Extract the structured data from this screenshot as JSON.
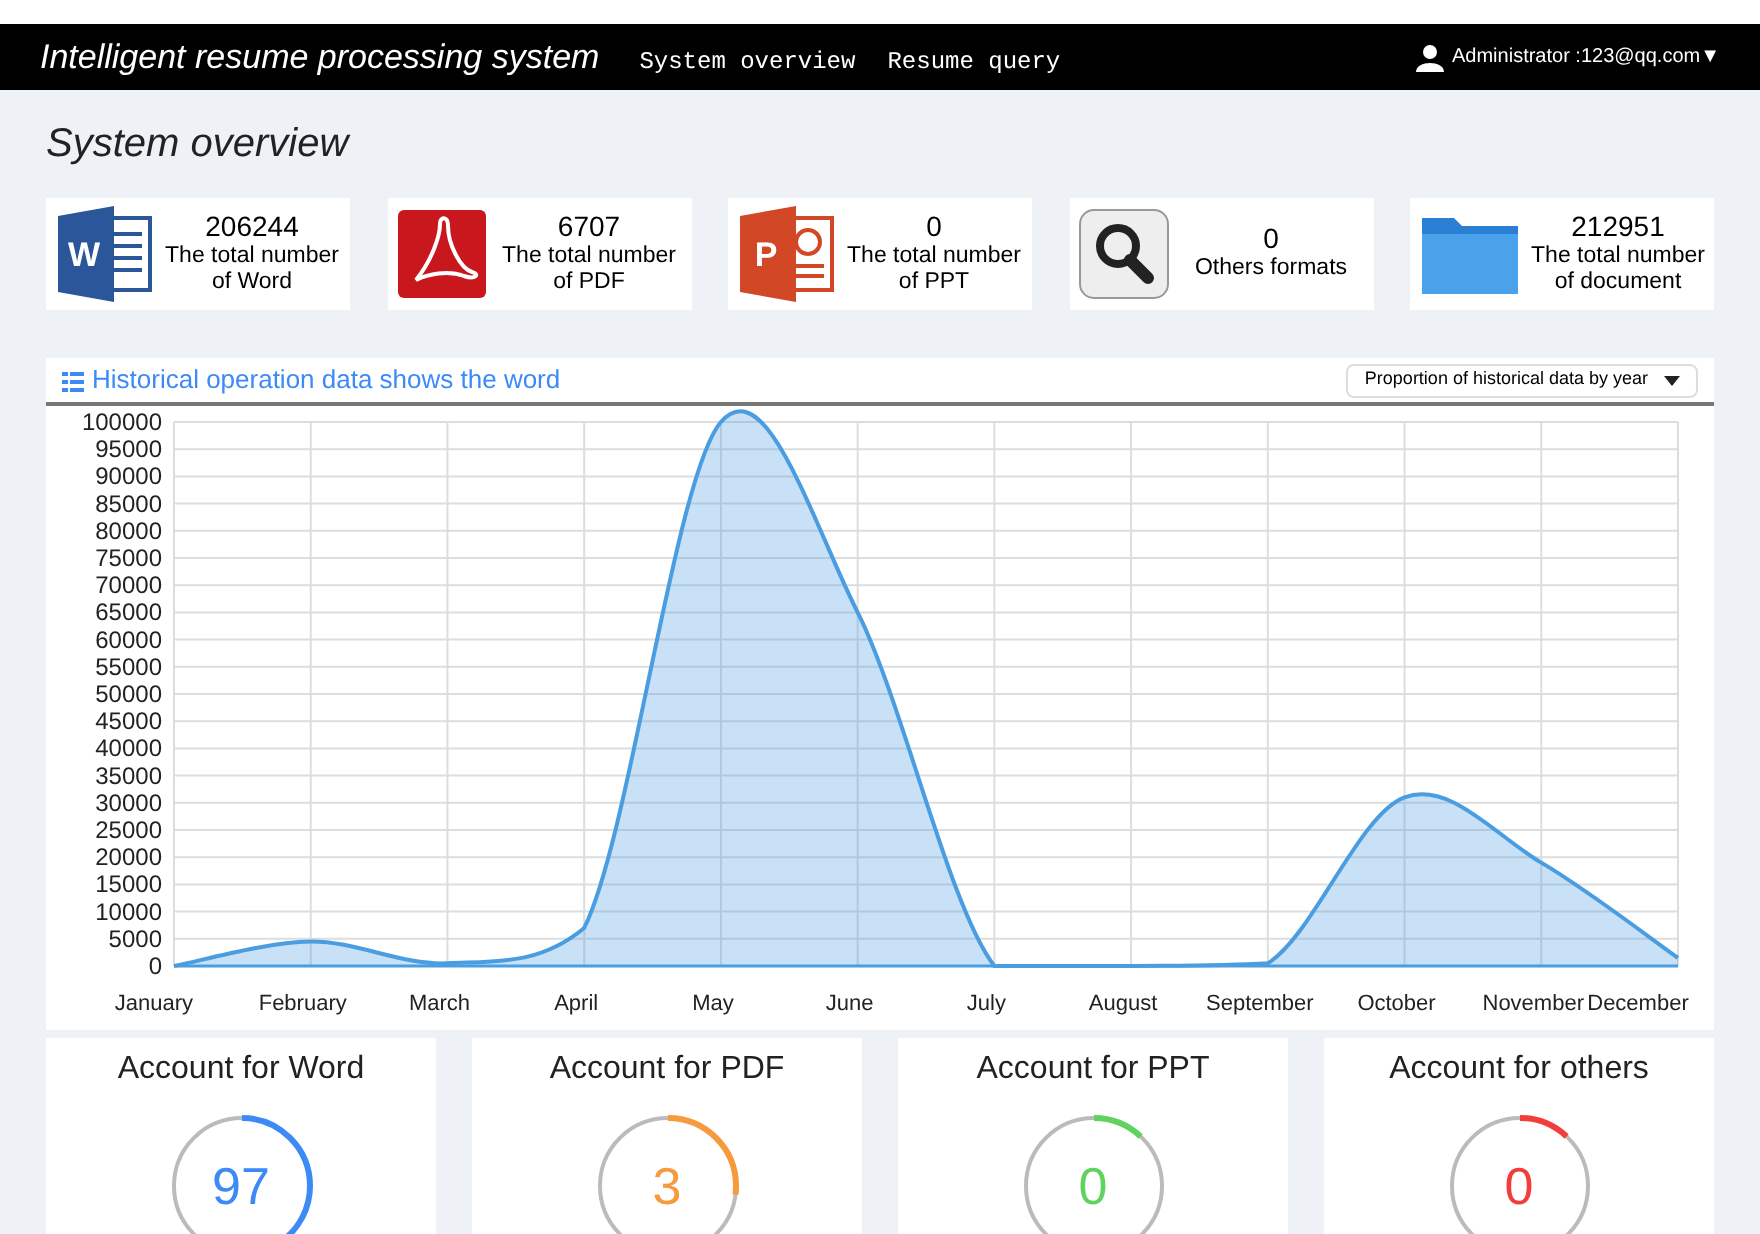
{
  "header": {
    "title": "Intelligent resume processing system",
    "nav": [
      {
        "label": "System overview"
      },
      {
        "label": "Resume query"
      }
    ],
    "user": "Administrator :123@qq.com▼"
  },
  "page_title": "System overview",
  "stats": [
    {
      "kind": "word",
      "icon_text": "W",
      "value": "206244",
      "label": "The total number of Word"
    },
    {
      "kind": "pdf",
      "value": "6707",
      "label": "The total number of PDF"
    },
    {
      "kind": "ppt",
      "icon_text": "P",
      "value": "0",
      "label": "The total number of PPT"
    },
    {
      "kind": "search",
      "value": "0",
      "label": "Others formats"
    },
    {
      "kind": "folder",
      "value": "212951",
      "label": "The total number of document"
    }
  ],
  "chart_panel": {
    "title": "Historical operation data shows the word",
    "dropdown": "Proportion of historical data by year",
    "chart_data": {
      "type": "area",
      "categories": [
        "January",
        "February",
        "March",
        "April",
        "May",
        "June",
        "July",
        "August",
        "September",
        "October",
        "November",
        "December"
      ],
      "grid": true,
      "series": [
        {
          "color": "#4a9de0",
          "values": [
            0,
            4500,
            500,
            7000,
            100000,
            65000,
            0,
            0,
            500,
            31000,
            19000,
            1500
          ]
        }
      ],
      "ylim": [
        0,
        100000
      ],
      "yticks": [
        0,
        5000,
        10000,
        15000,
        20000,
        25000,
        30000,
        35000,
        40000,
        45000,
        50000,
        55000,
        60000,
        65000,
        70000,
        75000,
        80000,
        85000,
        90000,
        95000,
        100000
      ]
    }
  },
  "gauges": [
    {
      "title": "Account for Word",
      "value": "97",
      "color": "#3d8af7",
      "level": 0.4
    },
    {
      "title": "Account for PDF",
      "value": "3",
      "color": "#f7993d",
      "level": 0.27
    },
    {
      "title": "Account for PPT",
      "value": "0",
      "color": "#5fd35f",
      "level": 0.12
    },
    {
      "title": "Account for others",
      "value": "0",
      "color": "#f23d3d",
      "level": 0.12
    }
  ]
}
